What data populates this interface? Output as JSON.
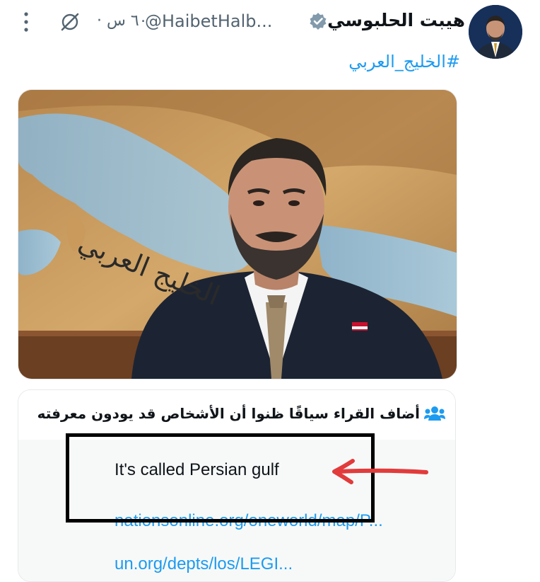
{
  "tweet": {
    "author": {
      "display_name": "هيبت الحلبوسي",
      "handle": "@HaibetHalb...",
      "verified_icon": "verified-badge-icon"
    },
    "timestamp": "٦٠ س ·",
    "hashtag": "#الخليج_العربي",
    "media": {
      "map_caption": "الخليج العربي"
    }
  },
  "community_note": {
    "header": "أضاف القراء سياقًا ظنوا أن الأشخاص قد يودون معرفته",
    "text": "It's called Persian gulf",
    "links": [
      "nationsonline.org/oneworld/map/P...",
      "un.org/depts/los/LEGI..."
    ]
  },
  "colors": {
    "link": "#1d9bf0",
    "muted": "#536471",
    "annotation_box": "#000000",
    "annotation_arrow": "#e23b3b"
  }
}
